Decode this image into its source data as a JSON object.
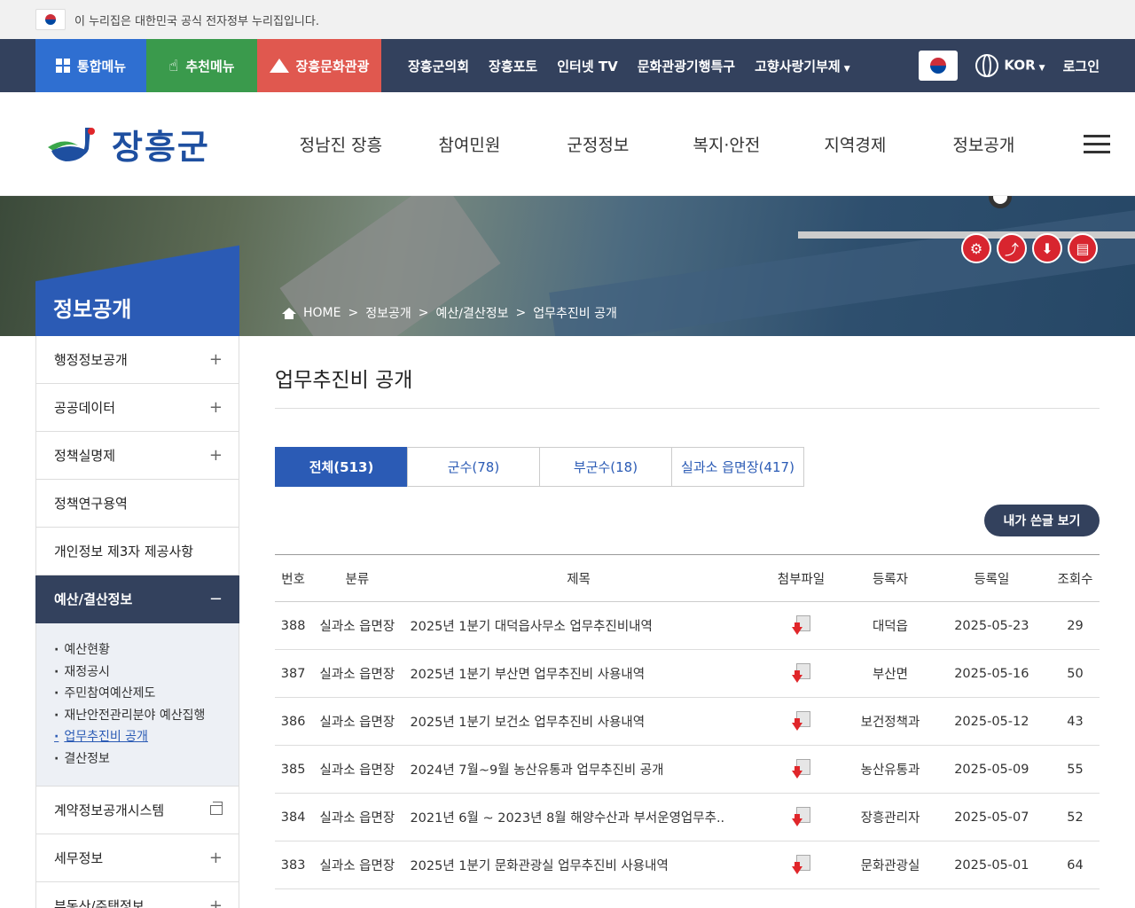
{
  "gov_banner": {
    "text": "이 누리집은 대한민국 공식 전자정부 누리집입니다."
  },
  "util": {
    "all_menu": "통합메뉴",
    "recommend_menu": "추천메뉴",
    "culture": "장흥문화관광",
    "links": [
      "장흥군의회",
      "장흥포토",
      "인터넷 TV",
      "문화관광기행특구",
      "고향사랑기부제"
    ],
    "lang": "KOR",
    "login": "로그인"
  },
  "header": {
    "logo_text": "장흥군",
    "gnb": [
      "정남진 장흥",
      "참여민원",
      "군정정보",
      "복지·안전",
      "지역경제",
      "정보공개"
    ]
  },
  "visual": {
    "section_title": "정보공개",
    "breadcrumb": [
      "HOME",
      ">",
      "정보공개",
      ">",
      "예산/결산정보",
      ">",
      "업무추진비 공개"
    ]
  },
  "sidebar": {
    "items_top": [
      "행정정보공개",
      "공공데이터",
      "정책실명제",
      "정책연구용역",
      "개인정보 제3자 제공사항"
    ],
    "active": "예산/결산정보",
    "sub": [
      "예산현황",
      "재정공시",
      "주민참여예산제도",
      "재난안전관리분야 예산집행",
      "업무추진비 공개",
      "결산정보"
    ],
    "items_bottom": [
      "계약정보공개시스템",
      "세무정보",
      "부동산/주택정보"
    ]
  },
  "content": {
    "title": "업무추진비 공개",
    "tabs": [
      "전체(513)",
      "군수(78)",
      "부군수(18)",
      "실과소 읍면장(417)"
    ],
    "my_post": "내가 쓴글 보기",
    "columns": [
      "번호",
      "분류",
      "제목",
      "첨부파일",
      "등록자",
      "등록일",
      "조회수"
    ],
    "rows": [
      {
        "no": "388",
        "cat": "실과소 읍면장",
        "title": "2025년 1분기 대덕읍사무소 업무추진비내역",
        "author": "대덕읍",
        "date": "2025-05-23",
        "views": "29"
      },
      {
        "no": "387",
        "cat": "실과소 읍면장",
        "title": "2025년 1분기 부산면 업무추진비 사용내역",
        "author": "부산면",
        "date": "2025-05-16",
        "views": "50"
      },
      {
        "no": "386",
        "cat": "실과소 읍면장",
        "title": "2025년 1분기 보건소 업무추진비 사용내역",
        "author": "보건정책과",
        "date": "2025-05-12",
        "views": "43"
      },
      {
        "no": "385",
        "cat": "실과소 읍면장",
        "title": "2024년 7월~9월 농산유통과 업무추진비 공개",
        "author": "농산유통과",
        "date": "2025-05-09",
        "views": "55"
      },
      {
        "no": "384",
        "cat": "실과소 읍면장",
        "title": "2021년 6월 ~ 2023년 8월 해양수산과 부서운영업무추..",
        "author": "장흥관리자",
        "date": "2025-05-07",
        "views": "52"
      },
      {
        "no": "383",
        "cat": "실과소 읍면장",
        "title": "2025년 1분기 문화관광실 업무추진비 사용내역",
        "author": "문화관광실",
        "date": "2025-05-01",
        "views": "64"
      }
    ]
  }
}
